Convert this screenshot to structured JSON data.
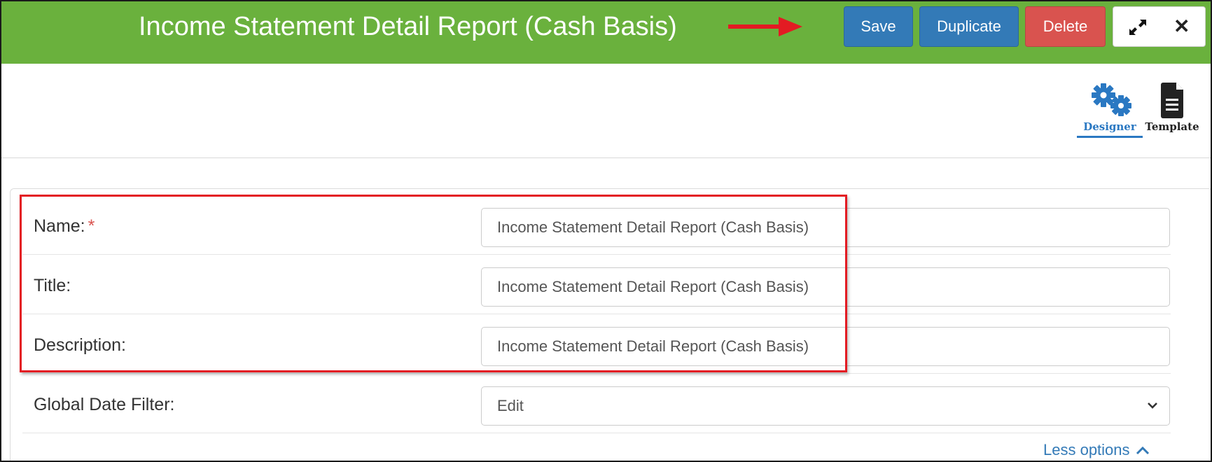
{
  "header": {
    "title": "Income Statement Detail Report (Cash Basis)",
    "save_label": "Save",
    "duplicate_label": "Duplicate",
    "delete_label": "Delete",
    "icons": [
      "expand-icon",
      "close-icon"
    ],
    "close_glyph": "✕"
  },
  "tabs": {
    "designer": {
      "label": "Designer",
      "icon": "gears-icon",
      "active": true
    },
    "template": {
      "label": "Template",
      "icon": "document-icon"
    }
  },
  "form": {
    "name": {
      "label": "Name:",
      "required_mark": "*",
      "value": "Income Statement Detail Report (Cash Basis)"
    },
    "title": {
      "label": "Title:",
      "value": "Income Statement Detail Report (Cash Basis)"
    },
    "description": {
      "label": "Description:",
      "value": "Income Statement Detail Report (Cash Basis)"
    },
    "global_date_filter": {
      "label": "Global Date Filter:",
      "value": "Edit"
    },
    "less_options_label": "Less options"
  },
  "colors": {
    "header_bg": "#6ab13d",
    "primary": "#337ab7",
    "danger": "#d9534f",
    "annotation": "#e31b23",
    "active_tab": "#2a78c2"
  }
}
